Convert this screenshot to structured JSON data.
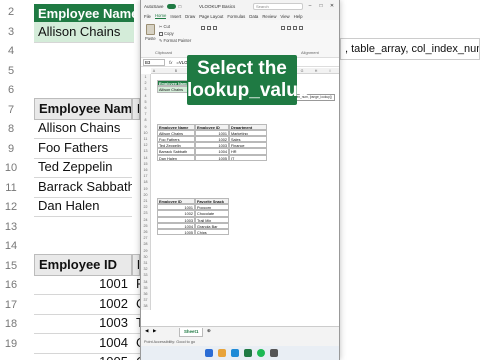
{
  "bg": {
    "top_headers": [
      "Employee Name",
      "E"
    ],
    "top_value": "Allison Chains",
    "top_row_nums": [
      "2",
      "3",
      "4",
      "5",
      "6",
      "7",
      "8",
      "9",
      "10",
      "11",
      "12",
      "13",
      "14",
      "15",
      "16",
      "17",
      "18",
      "19"
    ],
    "formula_fragment": ", table_array, col_index_num, [ran",
    "table2_headers": [
      "Employee Name",
      "E"
    ],
    "table2_names": [
      "Allison Chains",
      "Foo Fathers",
      "Ted Zeppelin",
      "Barrack Sabbath",
      "Dan Halen"
    ],
    "table3_headers": [
      "Employee ID",
      "F"
    ],
    "table3_ids": [
      "1001",
      "1002",
      "1003",
      "1004",
      "1005"
    ],
    "table3_right": [
      "P",
      "C",
      "T",
      "G",
      "C"
    ]
  },
  "excel": {
    "autosave": "AutoSave",
    "title": "VLOOKUP Basics",
    "search_placeholder": "Search",
    "tabs": [
      "File",
      "Home",
      "Insert",
      "Draw",
      "Page Layout",
      "Formulas",
      "Data",
      "Review",
      "View",
      "Help"
    ],
    "active_tab": "Home",
    "ribbon": {
      "paste": "Paste",
      "cut": "Cut",
      "copy": "Copy",
      "format_painter": "Format Painter",
      "clipboard": "Clipboard",
      "alignment": "Alignment"
    },
    "namebox": "B3",
    "fx": "fx",
    "formula": "=VLOOKUP(",
    "columns": [
      "A",
      "B",
      "C",
      "D",
      "E",
      "F",
      "G",
      "H",
      "I",
      "J"
    ],
    "rows": [
      "1",
      "2",
      "3",
      "4",
      "5",
      "6",
      "7",
      "8",
      "9",
      "10",
      "11",
      "12",
      "13",
      "14",
      "15",
      "16",
      "17",
      "18",
      "19",
      "20",
      "21",
      "22",
      "23",
      "24",
      "25",
      "26",
      "27",
      "28",
      "29",
      "30",
      "31",
      "32",
      "33",
      "34",
      "35",
      "36",
      "37",
      "38"
    ],
    "t1_headers": [
      "Employee Name",
      "Employee ID",
      "Favorite Snack"
    ],
    "t1_row": [
      "Allison Chains",
      "1001",
      "=VLOOKUP(C3"
    ],
    "tooltip": "VLOOKUP(lookup_value, table_array, col_index_num, [range_lookup])",
    "t2_headers": [
      "Employee Name",
      "Employee ID",
      "Department"
    ],
    "t2_rows": [
      [
        "Allison Chains",
        "1001",
        "Marketing"
      ],
      [
        "Foo Fathers",
        "1002",
        "Sales"
      ],
      [
        "Ted Zeppelin",
        "1003",
        "Finance"
      ],
      [
        "Barrack Sabbath",
        "1004",
        "HR"
      ],
      [
        "Dan Halen",
        "1005",
        "IT"
      ]
    ],
    "t3_headers": [
      "Employee ID",
      "Favorite Snack"
    ],
    "t3_rows": [
      [
        "1001",
        "Popcorn"
      ],
      [
        "1002",
        "Chocolate"
      ],
      [
        "1003",
        "Trail Mix"
      ],
      [
        "1004",
        "Granola Bar"
      ],
      [
        "1005",
        "Chips"
      ]
    ],
    "sheet_tab": "Sheet1",
    "status": "Point   Accessibility: Good to go"
  },
  "caption": {
    "line1": "Select the",
    "line2": "lookup_value"
  },
  "colors": {
    "excel_green": "#1f7a43",
    "header_green": "#1f7a43",
    "light_green": "#d4ecd9"
  }
}
